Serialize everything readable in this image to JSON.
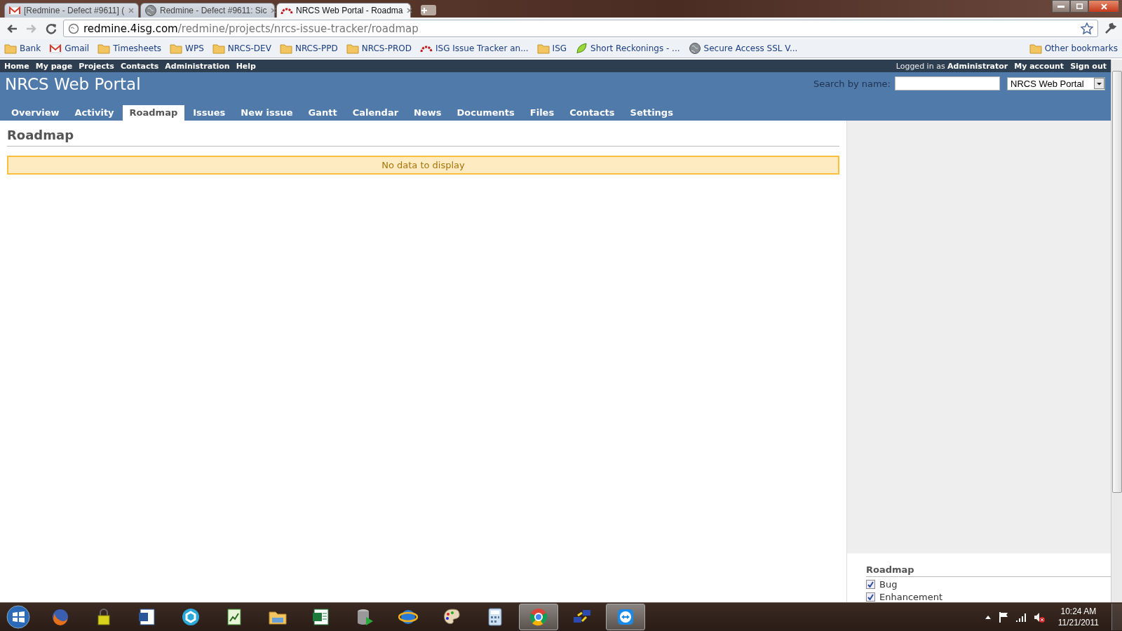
{
  "browser": {
    "tabs": [
      {
        "title": "[Redmine - Defect #9611] (",
        "selected": false
      },
      {
        "title": "Redmine - Defect #9611: Sic",
        "selected": false
      },
      {
        "title": "NRCS Web Portal - Roadma",
        "selected": true
      }
    ],
    "url": {
      "host": "redmine.4isg.com",
      "path": "/redmine/projects/nrcs-issue-tracker/roadmap"
    },
    "bookmarks": [
      {
        "label": "Bank"
      },
      {
        "label": "Gmail"
      },
      {
        "label": "Timesheets"
      },
      {
        "label": "WPS"
      },
      {
        "label": "NRCS-DEV"
      },
      {
        "label": "NRCS-PPD"
      },
      {
        "label": "NRCS-PROD"
      },
      {
        "label": "ISG Issue Tracker an..."
      },
      {
        "label": "ISG"
      },
      {
        "label": "Short Reckonings - ..."
      },
      {
        "label": "Secure Access SSL V..."
      }
    ],
    "other_bookmarks": "Other bookmarks"
  },
  "top_menu": [
    "Home",
    "My page",
    "Projects",
    "Contacts",
    "Administration",
    "Help"
  ],
  "account": {
    "prefix": "Logged in as",
    "user": "Administrator",
    "links": [
      "My account",
      "Sign out"
    ]
  },
  "header": {
    "title": "NRCS Web Portal",
    "search_label": "Search by name:",
    "project_select": "NRCS Web Portal"
  },
  "main_tabs": [
    {
      "label": "Overview",
      "selected": false
    },
    {
      "label": "Activity",
      "selected": false
    },
    {
      "label": "Roadmap",
      "selected": true
    },
    {
      "label": "Issues",
      "selected": false
    },
    {
      "label": "New issue",
      "selected": false
    },
    {
      "label": "Gantt",
      "selected": false
    },
    {
      "label": "Calendar",
      "selected": false
    },
    {
      "label": "News",
      "selected": false
    },
    {
      "label": "Documents",
      "selected": false
    },
    {
      "label": "Files",
      "selected": false
    },
    {
      "label": "Contacts",
      "selected": false
    },
    {
      "label": "Settings",
      "selected": false
    }
  ],
  "content": {
    "title": "Roadmap",
    "flash": "No data to display"
  },
  "sidebar": {
    "title": "Roadmap",
    "trackers": [
      {
        "label": "Bug",
        "checked": true
      },
      {
        "label": "Enhancement",
        "checked": true
      }
    ]
  },
  "taskbar": {
    "apps": [
      {
        "active": false
      },
      {
        "active": false
      },
      {
        "active": false
      },
      {
        "active": false
      },
      {
        "active": false
      },
      {
        "active": false
      },
      {
        "active": false
      },
      {
        "active": false
      },
      {
        "active": false
      },
      {
        "active": false
      },
      {
        "active": false
      },
      {
        "active": true
      },
      {
        "active": false
      },
      {
        "active": true
      }
    ],
    "time": "10:24 AM",
    "date": "11/21/2011"
  }
}
